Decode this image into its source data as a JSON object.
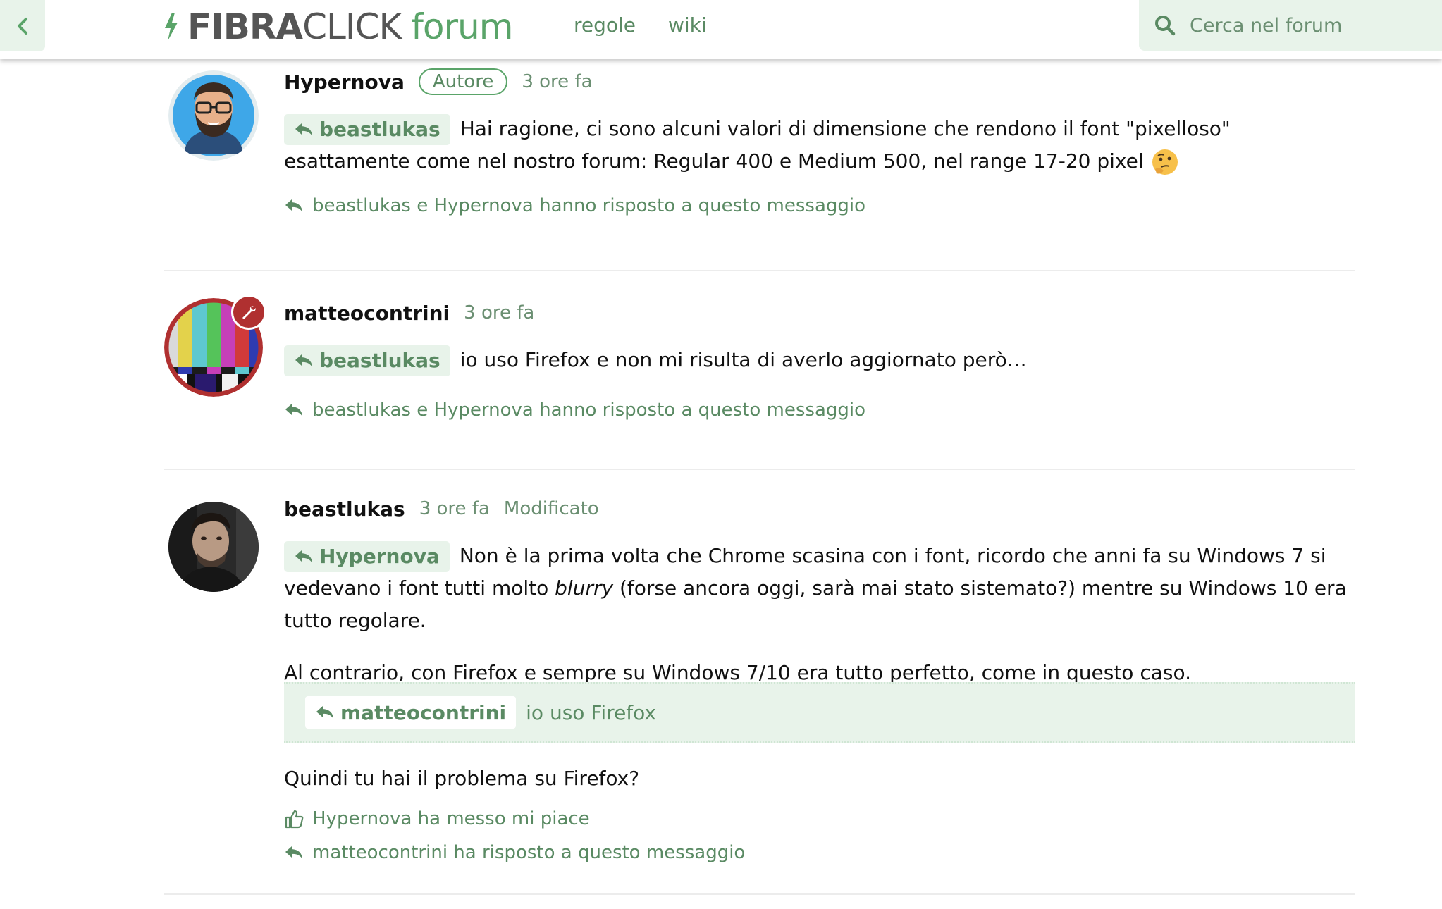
{
  "header": {
    "logo_bold": "FIBRA",
    "logo_light": "CLICK",
    "logo_forum": "forum",
    "nav": [
      "regole",
      "wiki"
    ],
    "search_placeholder": "Cerca nel forum"
  },
  "posts": [
    {
      "author": "Hypernova",
      "badge": "Autore",
      "time": "3 ore fa",
      "reply_to": "beastlukas",
      "text": "Hai ragione, ci sono alcuni valori di dimensione che rendono il font \"pixelloso\" esattamente come nel nostro forum: Regular 400 e Medium 500, nel range 17-20 pixel",
      "replies_note": "beastlukas e Hypernova hanno risposto a questo messaggio"
    },
    {
      "author": "matteocontrini",
      "time": "3 ore fa",
      "reply_to": "beastlukas",
      "text": "io uso Firefox e non mi risulta di averlo aggiornato però…",
      "replies_note": "beastlukas e Hypernova hanno risposto a questo messaggio"
    },
    {
      "author": "beastlukas",
      "time": "3 ore fa",
      "edited": "Modificato",
      "reply_to": "Hypernova",
      "text_before": "Non è la prima volta che Chrome scasina con i font, ricordo che anni fa su Windows 7 si vedevano i font tutti molto ",
      "text_em": "blurry",
      "text_after": " (forse ancora oggi, sarà mai stato sistemato?) mentre su Windows 10 era tutto regolare.",
      "paragraph2": "Al contrario, con Firefox e sempre su Windows 7/10 era tutto perfetto, come in questo caso.",
      "quote_author": "matteocontrini",
      "quote_text": "io uso Firefox",
      "paragraph3": "Quindi tu hai il problema su Firefox?",
      "like_note": "Hypernova ha messo mi piace",
      "replies_note": "matteocontrini ha risposto a questo messaggio"
    }
  ]
}
